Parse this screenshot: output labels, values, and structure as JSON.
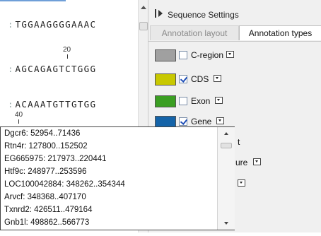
{
  "sequence": {
    "rows": [
      {
        "dots": ":",
        "bases": "TGGAAGGGGAAAC"
      },
      {
        "dots": ":",
        "bases": "AGCAGAGTCTGGG"
      },
      {
        "dots": ":",
        "bases": "ACAAATGTTGTGG"
      }
    ],
    "ruler_labels": [
      "20",
      "40"
    ]
  },
  "panel": {
    "title": "Sequence Settings",
    "tabs": [
      {
        "label": "Annotation layout",
        "active": false
      },
      {
        "label": "Annotation types",
        "active": true
      }
    ],
    "annotation_types": [
      {
        "label": "C-region",
        "color": "#a0a0a0",
        "checked": false
      },
      {
        "label": "CDS",
        "color": "#c8c800",
        "checked": true
      },
      {
        "label": "Exon",
        "color": "#3a9e22",
        "checked": false
      },
      {
        "label": "Gene",
        "color": "#1463a8",
        "checked": true
      },
      {
        "label": "t",
        "color": "",
        "checked": false
      },
      {
        "label": "ure",
        "color": "",
        "checked": false
      }
    ]
  },
  "popup": {
    "items": [
      "Dgcr6: 52954..71436",
      "Rtn4r: 127800..152502",
      "EG665975: 217973..220441",
      "Htf9c: 248977..253596",
      "LOC100042884: 348262..354344",
      "Arvcf: 348368..407170",
      "Txnrd2: 426511..479164",
      "Gnb1l: 498862..566773"
    ]
  }
}
